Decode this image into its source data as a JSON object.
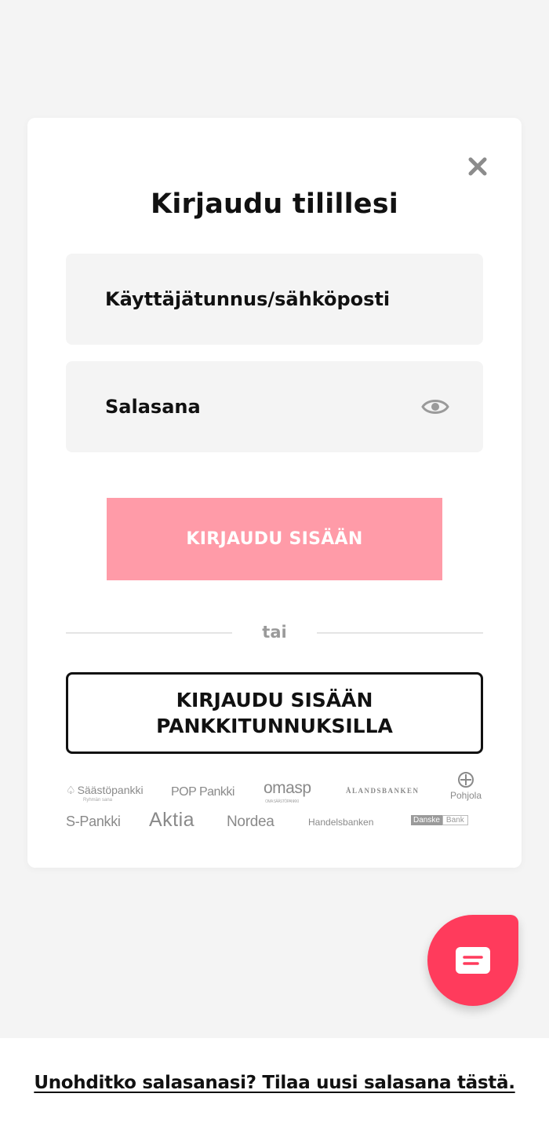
{
  "modal": {
    "title": "Kirjaudu tilillesi",
    "username_placeholder": "Käyttäjätunnus/sähköposti",
    "password_placeholder": "Salasana",
    "login_button": "KIRJAUDU SISÄÄN",
    "divider_text": "tai",
    "bank_button_line1": "KIRJAUDU SISÄÄN",
    "bank_button_line2": "PANKKITUNNUKSILLA"
  },
  "banks": {
    "saastopankki": "Säästöpankki",
    "saastopankki_sub": "Ryhmän sana",
    "pop": "POP Pankki",
    "omasp": "omasp",
    "omasp_sub": "OMA SÄÄSTÖPANKKI",
    "aland": "ÅLANDSBANKEN",
    "pohjola": "Pohjola",
    "spankki": "S-Pankki",
    "aktia": "Aktia",
    "nordea": "Nordea",
    "handelsbanken": "Handelsbanken",
    "danske_1": "Danske",
    "danske_2": "Bank"
  },
  "footer": {
    "forgot_link": "Unohditko salasanasi? Tilaa uusi salasana tästä."
  },
  "colors": {
    "accent": "#ff3b5c",
    "login_button_bg": "#ff9ba8",
    "field_bg": "#f4f4f4"
  },
  "icons": {
    "close": "close-icon",
    "eye": "eye-icon",
    "chat": "chat-icon"
  }
}
